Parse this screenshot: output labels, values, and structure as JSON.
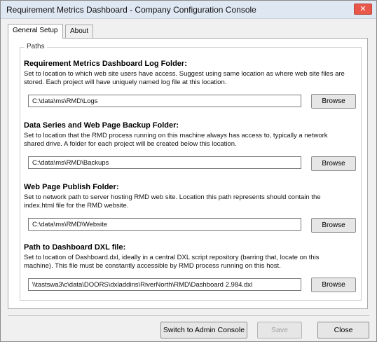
{
  "window": {
    "title": "Requirement Metrics Dashboard - Company Configuration Console",
    "close_glyph": "✕"
  },
  "tabs": [
    {
      "label": "General Setup",
      "active": true
    },
    {
      "label": "About",
      "active": false
    }
  ],
  "paths_group": {
    "legend": "Paths",
    "sections": [
      {
        "title": "Requirement Metrics Dashboard Log Folder:",
        "description": "Set to location to which web site users have access. Suggest using same location as where web site files are stored. Each project will have uniquely named log file at this location.",
        "value": "C:\\data\\ms\\RMD\\Logs",
        "browse_label": "Browse"
      },
      {
        "title": "Data Series and Web Page Backup Folder:",
        "description": "Set to location that the RMD process running on this machine always has access to, typically a network shared drive. A folder for each project will be created below this location.",
        "value": "C:\\data\\ms\\RMD\\Backups",
        "browse_label": "Browse"
      },
      {
        "title": "Web Page Publish Folder:",
        "description": "Set to network path to server hosting RMD web site. Location this path represents should contain the index.html file for the RMD website.",
        "value": "C:\\data\\ms\\RMD\\Website",
        "browse_label": "Browse"
      },
      {
        "title": "Path to Dashboard DXL file:",
        "description": "Set to location of Dashboard.dxl, ideally in a central DXL script repository (barring that, locate on this machine). This file must be constantly accessible by RMD process running on this host.",
        "value": "\\\\tastswa3\\c\\data\\DOORS\\dxladdins\\RiverNorth\\RMD\\Dashboard 2.984.dxl",
        "browse_label": "Browse"
      }
    ]
  },
  "footer": {
    "switch_label": "Switch to Admin Console",
    "save_label": "Save",
    "close_label": "Close"
  }
}
